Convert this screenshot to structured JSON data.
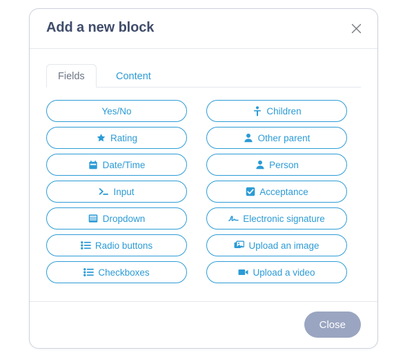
{
  "dialog": {
    "title": "Add a new block",
    "close_icon": "close-icon",
    "tabs": [
      {
        "label": "Fields",
        "active": true
      },
      {
        "label": "Content",
        "active": false
      }
    ],
    "fields": [
      {
        "label": "Yes/No",
        "icon": "none",
        "column": "left"
      },
      {
        "label": "Children",
        "icon": "child-icon",
        "column": "right"
      },
      {
        "label": "Rating",
        "icon": "star-icon",
        "column": "left"
      },
      {
        "label": "Other parent",
        "icon": "person-icon",
        "column": "right"
      },
      {
        "label": "Date/Time",
        "icon": "calendar-icon",
        "column": "left"
      },
      {
        "label": "Person",
        "icon": "person-icon",
        "column": "right"
      },
      {
        "label": "Input",
        "icon": "terminal-icon",
        "column": "left"
      },
      {
        "label": "Acceptance",
        "icon": "checkbox-icon",
        "column": "right"
      },
      {
        "label": "Dropdown",
        "icon": "dropdown-icon",
        "column": "left"
      },
      {
        "label": "Electronic signature",
        "icon": "signature-icon",
        "column": "right"
      },
      {
        "label": "Radio buttons",
        "icon": "list-icon",
        "column": "left"
      },
      {
        "label": "Upload an image",
        "icon": "image-icon",
        "column": "right"
      },
      {
        "label": "Checkboxes",
        "icon": "list-icon",
        "column": "left"
      },
      {
        "label": "Upload a video",
        "icon": "video-icon",
        "column": "right"
      }
    ],
    "footer": {
      "close_label": "Close"
    },
    "colors": {
      "accent": "#2c9bd6",
      "title": "#404d6b",
      "tab_active_text": "#6c7585",
      "border": "#e3e6ec",
      "dialog_border": "#ccd1dc",
      "close_button_bg": "#9aa5c1",
      "background": "#ffffff"
    }
  }
}
